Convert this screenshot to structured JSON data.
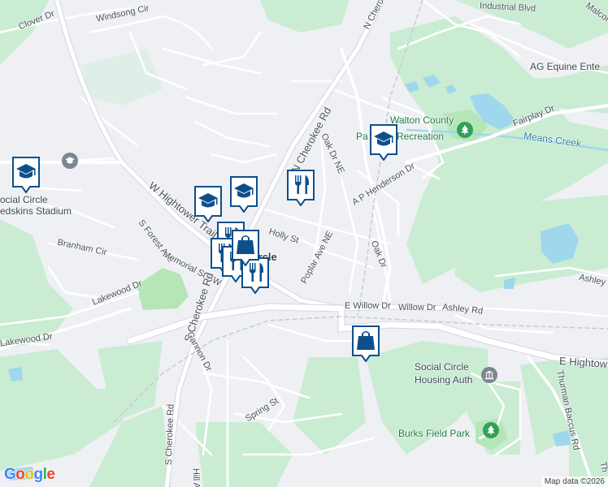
{
  "colors": {
    "land": "#eef0f3",
    "forest": "#c9ecd3",
    "park": "#b6e5b8",
    "water": "#9fd7ec",
    "road": "#ffffff",
    "road_edge": "#d3d7de",
    "pin": "#0d4f8b",
    "pin_bg": "#ffffff"
  },
  "streets": {
    "clover_dr": "Clover Dr",
    "windsong_cir": "Windsong Cir",
    "n_cherokee_top": "N Chero",
    "n_cherokee_rd": "N Cherokee Rd",
    "industrial_blvd": "Industrial Blvd",
    "malcom": "Malcom",
    "w_hightower": "W Hightower Trail",
    "holly_st": "Holly St",
    "oak_dr_ne": "Oak Dr NE",
    "oak_dr": "Oak Dr",
    "poplar_ave": "Poplar Ave NE",
    "ap_henderson": "A P Henderson Dr",
    "fairplay_dr": "Fairplay Dr",
    "s_forest_ave": "S Forest Ave",
    "memorial_st": "Memorial St SW",
    "branham_cir": "Branham Cir",
    "lakewood_dr_1": "Lakewood Dr",
    "lakewood_dr_2": "Lakewood Dr",
    "e_willow_dr": "E Willow Dr",
    "willow_dr": "Willow Dr",
    "ashley_rd": "Ashley Rd",
    "ashley_right": "Ashley",
    "e_hightower": "E Hightow",
    "s_cherokee_rd_1": "S Cherokee Rd",
    "s_cherokee_rd_2": "S Cherokee Rd",
    "cannon_dr": "Cannon Dr",
    "spring_st": "Spring St",
    "hill_ave": "Hill A",
    "thurman_baccus": "Thurman Baccus Rd",
    "th_right": "Th",
    "circle_fragment": "ircle"
  },
  "places": {
    "ag_equine": "AG Equine Ente",
    "walton_county_1": "Walton County",
    "walton_county_2": "Pa",
    "recreation": "Recreation",
    "means_creek": "Means Creek",
    "stadium_1": "ocial Circle",
    "stadium_2": "edskins Stadium",
    "housing_1": "Social Circle",
    "housing_2": "Housing Auth",
    "burks_park": "Burks Field Park"
  },
  "pins": [
    {
      "name": "school-pin-1",
      "icon": "school"
    },
    {
      "name": "school-pin-2",
      "icon": "school"
    },
    {
      "name": "school-pin-3",
      "icon": "school"
    },
    {
      "name": "school-pin-4",
      "icon": "school"
    },
    {
      "name": "restaurant-pin-1",
      "icon": "restaurant"
    },
    {
      "name": "restaurant-pin-2",
      "icon": "restaurant"
    },
    {
      "name": "restaurant-pin-3",
      "icon": "restaurant"
    },
    {
      "name": "restaurant-pin-4",
      "icon": "restaurant"
    },
    {
      "name": "restaurant-pin-5",
      "icon": "restaurant"
    },
    {
      "name": "shopping-pin-1",
      "icon": "shopping"
    },
    {
      "name": "shopping-pin-2",
      "icon": "shopping"
    }
  ],
  "attribution": {
    "logo": "Google",
    "map_data": "Map data ©2026"
  }
}
